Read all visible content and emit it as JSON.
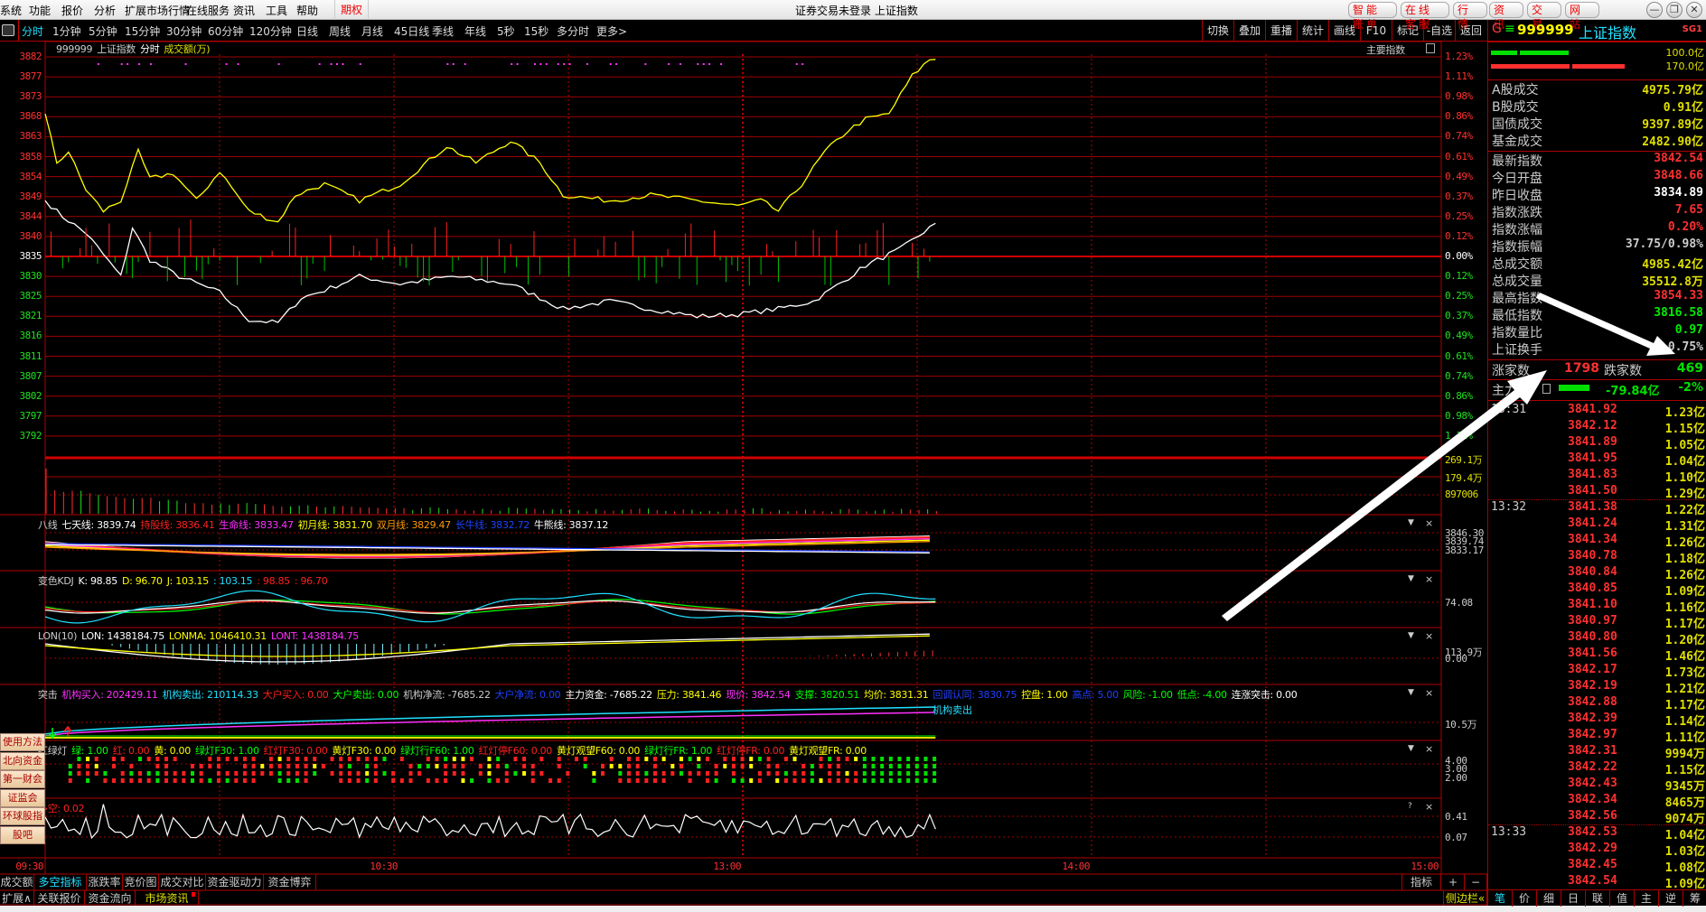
{
  "menu": [
    "系统",
    "功能",
    "报价",
    "分析",
    "扩展市场行情",
    "在线服务",
    "资讯",
    "工具",
    "帮助"
  ],
  "option_menu": "期权",
  "window_title": "证券交易未登录  上证指数",
  "top_buttons": [
    "智能账单",
    "在线客服",
    "行 情",
    "资 讯",
    "交 易",
    "网 站"
  ],
  "window_controls": [
    "—",
    "❐",
    "✕"
  ],
  "periods": [
    "分时",
    "1分钟",
    "5分钟",
    "15分钟",
    "30分钟",
    "60分钟",
    "120分钟",
    "日线",
    "周线",
    "月线",
    "45日线",
    "季线",
    "年线",
    "5秒",
    "15秒",
    "多分时",
    "更多>"
  ],
  "active_period": "分时",
  "tools": [
    "切换",
    "叠加",
    "重播",
    "统计",
    "画线",
    "F10",
    "标记",
    "-自选",
    "返回"
  ],
  "chart_header": {
    "code": "999999",
    "name": "上证指数",
    "mode": "分时",
    "indicator": "成交额(万)",
    "main_index": "主要指数"
  },
  "price_axis": [
    "3882",
    "3877",
    "3873",
    "3868",
    "3863",
    "3858",
    "3854",
    "3849",
    "3844",
    "3840",
    "3835",
    "3830",
    "3825",
    "3821",
    "3816",
    "3811",
    "3807",
    "3802",
    "3797",
    "3792"
  ],
  "pct_axis": [
    "1.23%",
    "1.11%",
    "0.98%",
    "0.86%",
    "0.74%",
    "0.61%",
    "0.49%",
    "0.37%",
    "0.25%",
    "0.12%",
    "0.00%",
    "0.12%",
    "0.25%",
    "0.37%",
    "0.49%",
    "0.61%",
    "0.74%",
    "0.86%",
    "0.98%",
    "1.11%"
  ],
  "vol_axis": [
    "269.1万",
    "179.4万",
    "897006"
  ],
  "panel_axes": {
    "bax": [
      "3846.30",
      "3839.74",
      "3833.17"
    ],
    "kdj": [
      "74.08"
    ],
    "lon": [
      "113.9万",
      "0.00"
    ],
    "tuji": [
      "10.5万"
    ],
    "hld": [
      "4.00",
      "3.00",
      "2.00"
    ],
    "dk": [
      "0.41",
      "0.07"
    ]
  },
  "panels": {
    "bax": [
      {
        "t": "八线",
        "c": "#cccccc"
      },
      {
        "t": "七天线: 3839.74",
        "c": "#ffffff"
      },
      {
        "t": "持股线: 3836.41",
        "c": "#ff2020"
      },
      {
        "t": "生命线: 3833.47",
        "c": "#ff30ff"
      },
      {
        "t": "初月线: 3831.70",
        "c": "#ffff00"
      },
      {
        "t": "双月线: 3829.47",
        "c": "#ff9900"
      },
      {
        "t": "长牛线: 3832.72",
        "c": "#2040ff"
      },
      {
        "t": "牛熊线: 3837.12",
        "c": "#ffffff"
      }
    ],
    "kdj": [
      {
        "t": "变色KDJ",
        "c": "#cccccc"
      },
      {
        "t": "K: 98.85",
        "c": "#ffffff"
      },
      {
        "t": "D: 96.70",
        "c": "#ffff00"
      },
      {
        "t": "J: 103.15",
        "c": "#ffff00"
      },
      {
        "t": ": 103.15",
        "c": "#20e0ff"
      },
      {
        "t": ": 98.85",
        "c": "#ff2020"
      },
      {
        "t": ": 96.70",
        "c": "#ff2020"
      }
    ],
    "lon": [
      {
        "t": "LON(10)",
        "c": "#cccccc"
      },
      {
        "t": "LON: 1438184.75",
        "c": "#ffffff"
      },
      {
        "t": "LONMA: 1046410.31",
        "c": "#ffff00"
      },
      {
        "t": "LONT: 1438184.75",
        "c": "#ff30ff"
      }
    ],
    "tuji": [
      {
        "t": "突击",
        "c": "#cccccc"
      },
      {
        "t": "机构买入: 202429.11",
        "c": "#ff30ff"
      },
      {
        "t": "机构卖出: 210114.33",
        "c": "#20e0ff"
      },
      {
        "t": "大户买入: 0.00",
        "c": "#ff2020"
      },
      {
        "t": "大户卖出: 0.00",
        "c": "#00ff00"
      },
      {
        "t": "机构净流: -7685.22",
        "c": "#cccccc"
      },
      {
        "t": "大户净流: 0.00",
        "c": "#2040ff"
      },
      {
        "t": "主力资金: -7685.22",
        "c": "#ffffff"
      },
      {
        "t": "压力: 3841.46",
        "c": "#ffff00"
      },
      {
        "t": "现价: 3842.54",
        "c": "#ff30ff"
      },
      {
        "t": "支撑: 3820.51",
        "c": "#00ff00"
      },
      {
        "t": "均价: 3831.31",
        "c": "#ffff00"
      },
      {
        "t": "回调认同: 3830.75",
        "c": "#2040ff"
      },
      {
        "t": "控盘: 1.00",
        "c": "#ffff00"
      },
      {
        "t": "高点: 5.00",
        "c": "#2040ff"
      },
      {
        "t": "风险: -1.00",
        "c": "#00ff00"
      },
      {
        "t": "低点: -4.00",
        "c": "#00ff00"
      },
      {
        "t": "连涨突击: 0.00",
        "c": "#ffffff"
      }
    ],
    "hld": [
      {
        "t": "红绿灯",
        "c": "#cccccc"
      },
      {
        "t": "绿: 1.00",
        "c": "#00ff00"
      },
      {
        "t": "红: 0.00",
        "c": "#ff2020"
      },
      {
        "t": "黄: 0.00",
        "c": "#ffff00"
      },
      {
        "t": "绿灯F30: 1.00",
        "c": "#00ff00"
      },
      {
        "t": "红灯F30: 0.00",
        "c": "#ff2020"
      },
      {
        "t": "黄灯F30: 0.00",
        "c": "#ffff00"
      },
      {
        "t": "绿灯行F60: 1.00",
        "c": "#00ff00"
      },
      {
        "t": "红灯停F60: 0.00",
        "c": "#ff2020"
      },
      {
        "t": "黄灯观望F60: 0.00",
        "c": "#ffff00"
      },
      {
        "t": "绿灯行FR: 1.00",
        "c": "#00ff00"
      },
      {
        "t": "红灯停FR: 0.00",
        "c": "#ff2020"
      },
      {
        "t": "黄灯观望FR: 0.00",
        "c": "#ffff00"
      }
    ],
    "dk": [
      {
        "t": "多空: 0.02",
        "c": "#ff2020"
      }
    ]
  },
  "tuji_note": "机构卖出",
  "time_axis": [
    "09:30",
    "10:30",
    "13:00",
    "14:00",
    "15:00"
  ],
  "bottom_tabs": [
    "成交额",
    "多空指标",
    "涨跌率",
    "竞价图",
    "成交对比",
    "资金驱动力",
    "资金博弈"
  ],
  "active_bottom_tab": "多空指标",
  "bottom_tabs2": [
    "扩展∧",
    "关联报价",
    "资金流向",
    "市场资讯"
  ],
  "indicator_btn": "指标",
  "plus_btn": "+",
  "minus_btn": "−",
  "side_buttons": [
    "使用方法",
    "北向资金",
    "第一财会",
    "证监会",
    "环球股指",
    "股吧"
  ],
  "sidebar_toggle": "侧边栏«",
  "right_tabs": [
    "笔",
    "价",
    "细",
    "日",
    "联",
    "值",
    "主",
    "逆",
    "筹"
  ],
  "quote": {
    "g": "G",
    "eq": "≡",
    "code": "999999",
    "name": "上证指数",
    "tag": "SG1",
    "bar_values": [
      "100.0亿",
      "170.0亿"
    ],
    "turnover": [
      {
        "label": "A股成交",
        "value": "4975.79亿",
        "color": "#e0e000"
      },
      {
        "label": "B股成交",
        "value": "0.91亿",
        "color": "#e0e000"
      },
      {
        "label": "国债成交",
        "value": "9397.89亿",
        "color": "#e0e000"
      },
      {
        "label": "基金成交",
        "value": "2482.90亿",
        "color": "#e0e000"
      }
    ],
    "stats": [
      {
        "label": "最新指数",
        "value": "3842.54",
        "color": "#ff3030"
      },
      {
        "label": "今日开盘",
        "value": "3848.66",
        "color": "#ff3030"
      },
      {
        "label": "昨日收盘",
        "value": "3834.89",
        "color": "#ffffff"
      },
      {
        "label": "指数涨跌",
        "value": "7.65",
        "color": "#ff3030"
      },
      {
        "label": "指数涨幅",
        "value": "0.20%",
        "color": "#ff3030"
      },
      {
        "label": "指数振幅",
        "value": "37.75/0.98%",
        "color": "#cccccc"
      },
      {
        "label": "总成交额",
        "value": "4985.42亿",
        "color": "#e0e000"
      },
      {
        "label": "总成交量",
        "value": "35512.8万",
        "color": "#e0e000"
      },
      {
        "label": "最高指数",
        "value": "3854.33",
        "color": "#ff3030"
      },
      {
        "label": "最低指数",
        "value": "3816.58",
        "color": "#00ee00"
      },
      {
        "label": "指数量比",
        "value": "0.97",
        "color": "#00ee00"
      },
      {
        "label": "上证换手",
        "value": "0.75%",
        "color": "#cccccc"
      }
    ],
    "up_label": "涨家数",
    "up_count": "1798",
    "down_label": "跌家数",
    "down_count": "469",
    "main_force_label": "主力",
    "main_force_value": "-79.84亿",
    "main_force_pct": "-2%"
  },
  "ticks": [
    {
      "time": "13:31",
      "price": "3841.92",
      "amount": "1.23亿"
    },
    {
      "time": "",
      "price": "3842.12",
      "amount": "1.15亿"
    },
    {
      "time": "",
      "price": "3841.89",
      "amount": "1.05亿"
    },
    {
      "time": "",
      "price": "3841.95",
      "amount": "1.04亿"
    },
    {
      "time": "",
      "price": "3841.83",
      "amount": "1.10亿"
    },
    {
      "time": "",
      "price": "3841.50",
      "amount": "1.29亿"
    },
    {
      "time": "13:32",
      "price": "3841.38",
      "amount": "1.22亿"
    },
    {
      "time": "",
      "price": "3841.24",
      "amount": "1.31亿"
    },
    {
      "time": "",
      "price": "3841.34",
      "amount": "1.26亿"
    },
    {
      "time": "",
      "price": "3840.78",
      "amount": "1.18亿"
    },
    {
      "time": "",
      "price": "3840.84",
      "amount": "1.26亿"
    },
    {
      "time": "",
      "price": "3840.85",
      "amount": "1.09亿"
    },
    {
      "time": "",
      "price": "3841.10",
      "amount": "1.16亿"
    },
    {
      "time": "",
      "price": "3840.97",
      "amount": "1.17亿"
    },
    {
      "time": "",
      "price": "3840.80",
      "amount": "1.20亿"
    },
    {
      "time": "",
      "price": "3841.56",
      "amount": "1.46亿"
    },
    {
      "time": "",
      "price": "3842.17",
      "amount": "1.73亿"
    },
    {
      "time": "",
      "price": "3842.19",
      "amount": "1.21亿"
    },
    {
      "time": "",
      "price": "3842.88",
      "amount": "1.17亿"
    },
    {
      "time": "",
      "price": "3842.39",
      "amount": "1.14亿"
    },
    {
      "time": "",
      "price": "3842.97",
      "amount": "1.11亿"
    },
    {
      "time": "",
      "price": "3842.31",
      "amount": "9994万"
    },
    {
      "time": "",
      "price": "3842.22",
      "amount": "1.15亿"
    },
    {
      "time": "",
      "price": "3842.43",
      "amount": "9345万"
    },
    {
      "time": "",
      "price": "3842.34",
      "amount": "8465万"
    },
    {
      "time": "",
      "price": "3842.56",
      "amount": "9074万"
    },
    {
      "time": "13:33",
      "price": "3842.53",
      "amount": "1.04亿"
    },
    {
      "time": "",
      "price": "3842.29",
      "amount": "1.03亿"
    },
    {
      "time": "",
      "price": "3842.45",
      "amount": "1.08亿"
    },
    {
      "time": "",
      "price": "3842.54",
      "amount": "1.09亿"
    }
  ],
  "chart_data": {
    "type": "line",
    "prev_close": 3834.89,
    "ylim": [
      3792,
      3882
    ],
    "minutes_total": 240,
    "series": [
      {
        "name": "index",
        "color": "#ffffff",
        "points": [
          [
            0,
            3847.9
          ],
          [
            3,
            3844.1
          ],
          [
            7,
            3840.2
          ],
          [
            10,
            3835.1
          ],
          [
            13,
            3829.9
          ],
          [
            15,
            3841.5
          ],
          [
            18,
            3833.8
          ],
          [
            23,
            3829.9
          ],
          [
            30,
            3826.1
          ],
          [
            35,
            3819.6
          ],
          [
            40,
            3818.9
          ],
          [
            44,
            3824.8
          ],
          [
            48,
            3826.6
          ],
          [
            54,
            3829.9
          ],
          [
            61,
            3828.1
          ],
          [
            70,
            3829.9
          ],
          [
            80,
            3828.1
          ],
          [
            89,
            3822.2
          ],
          [
            97,
            3824.0
          ],
          [
            104,
            3822.2
          ],
          [
            112,
            3820.4
          ],
          [
            119,
            3820.9
          ],
          [
            126,
            3822.2
          ],
          [
            132,
            3824.0
          ],
          [
            137,
            3828.6
          ],
          [
            141,
            3832.5
          ],
          [
            147,
            3836.4
          ],
          [
            153,
            3842.5
          ]
        ]
      },
      {
        "name": "unweighted",
        "color": "#ffff00",
        "points": [
          [
            0,
            3868.5
          ],
          [
            2,
            3856.9
          ],
          [
            4,
            3859.5
          ],
          [
            7,
            3850.5
          ],
          [
            10,
            3845.4
          ],
          [
            13,
            3847.9
          ],
          [
            16,
            3859.5
          ],
          [
            18,
            3853.1
          ],
          [
            22,
            3854.4
          ],
          [
            26,
            3847.9
          ],
          [
            30,
            3854.9
          ],
          [
            35,
            3845.4
          ],
          [
            40,
            3842.8
          ],
          [
            43,
            3849.2
          ],
          [
            48,
            3851.8
          ],
          [
            54,
            3847.9
          ],
          [
            61,
            3851.8
          ],
          [
            69,
            3860.8
          ],
          [
            74,
            3856.9
          ],
          [
            80,
            3862.1
          ],
          [
            85,
            3856.9
          ],
          [
            89,
            3849.2
          ],
          [
            97,
            3847.9
          ],
          [
            104,
            3849.2
          ],
          [
            112,
            3847.9
          ],
          [
            119,
            3846.6
          ],
          [
            123,
            3847.9
          ],
          [
            126,
            3845.4
          ],
          [
            130,
            3851.8
          ],
          [
            134,
            3859.5
          ],
          [
            138,
            3864.6
          ],
          [
            141,
            3867.2
          ],
          [
            145,
            3868.5
          ],
          [
            149,
            3877.5
          ],
          [
            152,
            3881.4
          ]
        ]
      }
    ]
  }
}
